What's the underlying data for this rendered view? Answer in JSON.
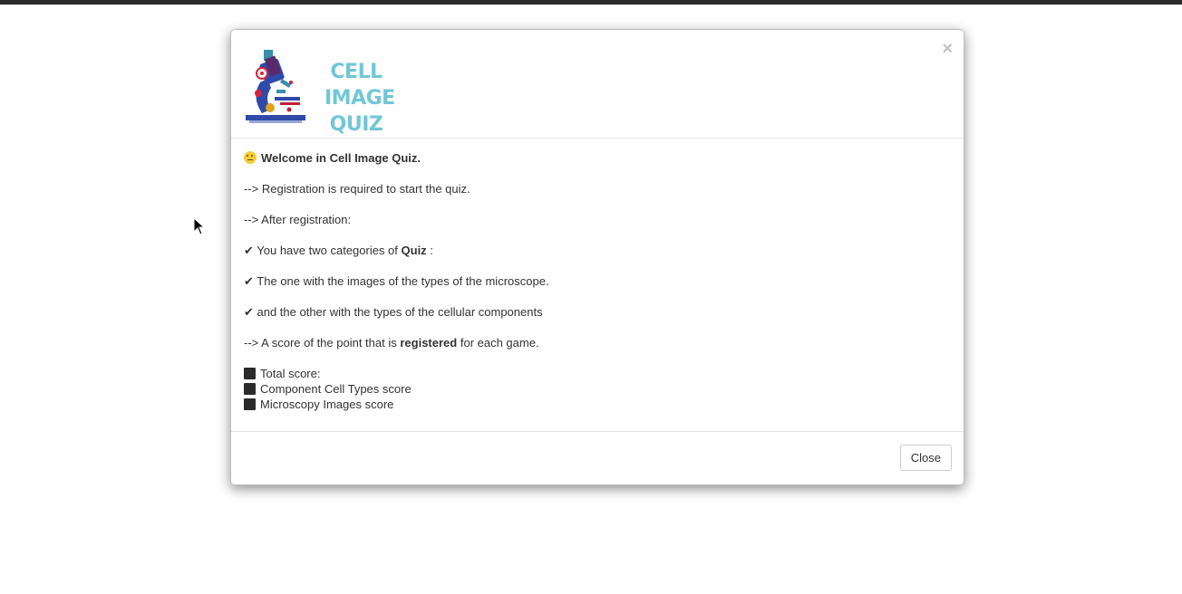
{
  "modal": {
    "logo_lines": [
      "CELL",
      "IMAGE",
      "QUIZ"
    ],
    "close_glyph": "×",
    "body": {
      "welcome": "Welcome in Cell Image Quiz.",
      "registration_required": "--> Registration is required to start the quiz.",
      "after_registration": "--> After registration:",
      "categories_prefix": "✔ You have two categories of ",
      "categories_bold": "Quiz",
      "categories_suffix": " :",
      "category_one": "✔ The one with the images of the types of the microscope.",
      "category_two": "✔ and the other with the types of the cellular components",
      "score_prefix": "--> A score of the point that is ",
      "score_bold": "registered",
      "score_suffix": " for each game.",
      "scores": [
        "Total score:",
        "Component Cell Types score",
        "Microscopy Images score"
      ]
    },
    "footer": {
      "close_label": "Close"
    }
  },
  "colors": {
    "logo_text": "#72c7d6",
    "topbar": "#2b2b2b",
    "microscope_blue": "#2f4aa8"
  },
  "icons": [
    "microscope-logo",
    "thinking-face-emoji",
    "close-icon",
    "black-square-icon",
    "mouse-cursor-icon"
  ]
}
